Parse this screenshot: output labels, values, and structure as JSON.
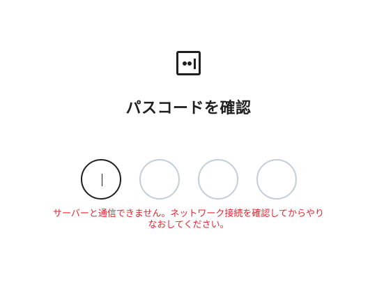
{
  "app": {
    "logo_icon": "passcode-logo-icon"
  },
  "header": {
    "title": "パスコードを確認"
  },
  "passcode": {
    "length": 4,
    "active_index": 0,
    "colors": {
      "active_border": "#1f1f1f",
      "inactive_border": "#c3ced6"
    }
  },
  "error": {
    "line1": "サーバーと通信できません。ネットワーク接続を確認してからやり",
    "line2": "なおしてください。",
    "color": "#e8242f"
  }
}
